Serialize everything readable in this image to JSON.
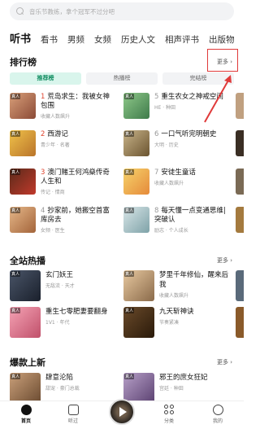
{
  "search": {
    "placeholder": "音乐节教练，拿个冠军不过分吧"
  },
  "tabs": [
    "听书",
    "看书",
    "男频",
    "女频",
    "历史人文",
    "相声评书",
    "出版物"
  ],
  "rank_section": {
    "title": "排行榜",
    "more": "更多",
    "segments": [
      "推荐榜",
      "热播榜",
      "完结榜"
    ],
    "items": [
      {
        "num": "1",
        "title": "荒岛求生：我被女神包围",
        "sub": "收藏人数飙升"
      },
      {
        "num": "5",
        "title": "重生农女之神戒空间",
        "sub": "HE · 种田"
      },
      {
        "num": "2",
        "title": "西游记",
        "sub": "青少年 · 名著"
      },
      {
        "num": "6",
        "title": "一口气听完明朝史",
        "sub": "大明 · 历史"
      },
      {
        "num": "3",
        "title": "澳门赌王何鸿燊传奇人生和",
        "sub": "传记 · 情商"
      },
      {
        "num": "7",
        "title": "安徒生童话",
        "sub": "收藏人数飙升"
      },
      {
        "num": "4",
        "title": "抄家前，她搬空首富库房去",
        "sub": "女频 · 医生"
      },
      {
        "num": "8",
        "title": "每天懂一点变通思维|突破认",
        "sub": "励志 · 个人成长"
      }
    ]
  },
  "hot_section": {
    "title": "全站热播",
    "more": "更多",
    "items": [
      {
        "title": "玄门妖王",
        "sub": "无敌流 · 天才"
      },
      {
        "title": "梦里千年修仙，醒来后我",
        "sub": "收藏人数飙升"
      },
      {
        "title": "重生七零肥妻要翻身",
        "sub": "1V1 · 年代"
      },
      {
        "title": "九天斩神诀",
        "sub": "节奏紧凑"
      }
    ]
  },
  "new_section": {
    "title": "爆款上新",
    "more": "更多",
    "items": [
      {
        "title": "肆意沦陷",
        "sub": "甜宠 · 豪门总裁"
      },
      {
        "title": "邪王的庶女狂妃",
        "sub": "宫廷 · 种田"
      }
    ]
  },
  "cover_badge": "真人",
  "bottom_nav": [
    "首页",
    "听过",
    "分类",
    "我的"
  ],
  "colors": {
    "accent": "#0d8b5e",
    "rank_num": "#e0452f",
    "highlight_box": "#e03a3a"
  }
}
